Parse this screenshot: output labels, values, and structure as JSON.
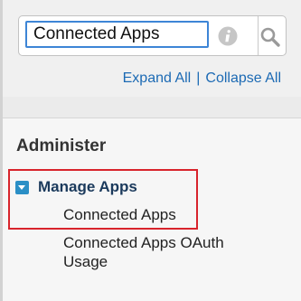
{
  "search": {
    "value": "Connected Apps",
    "info_icon": "info-icon",
    "button_icon": "search-icon"
  },
  "tree_controls": {
    "expand_all": "Expand All",
    "separator": "|",
    "collapse_all": "Collapse All"
  },
  "nav": {
    "section_title": "Administer",
    "group": {
      "label": "Manage Apps",
      "toggle_icon": "collapse-toggle-icon",
      "items": [
        {
          "label": "Connected Apps"
        },
        {
          "label": "Connected Apps OAuth Usage"
        }
      ]
    }
  },
  "colors": {
    "link": "#1c6ab4",
    "input_focus_border": "#3d85d6",
    "highlight_border": "#d8242c",
    "toggle_icon": "#2a8fc6"
  }
}
